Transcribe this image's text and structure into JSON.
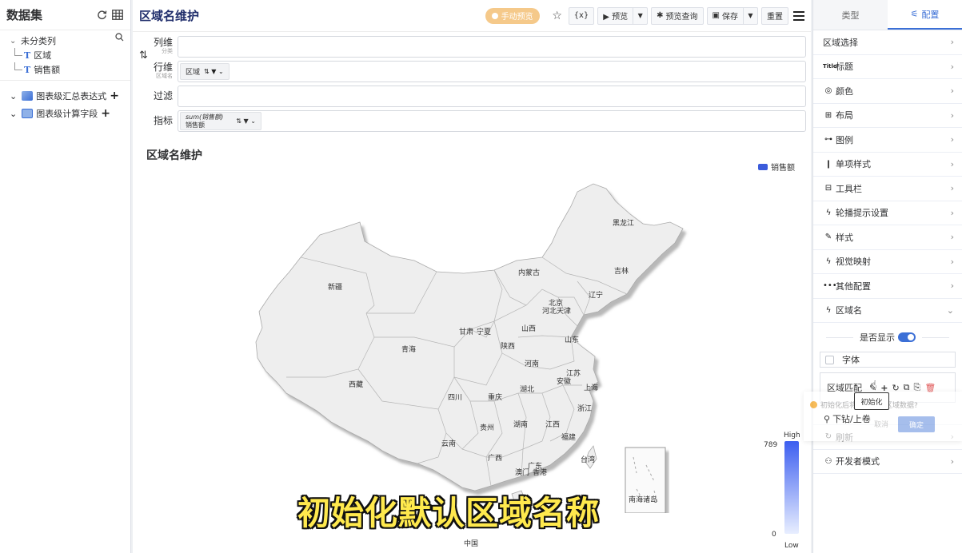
{
  "left_panel": {
    "title": "数据集",
    "tree_root": "未分类列",
    "fields": [
      {
        "icon": "T",
        "label": "区域"
      },
      {
        "icon": "T",
        "label": "销售额"
      }
    ],
    "groups": [
      "图表级汇总表达式",
      "图表级计算字段"
    ]
  },
  "topbar": {
    "title": "区域名维护",
    "manual_preview": "手动预览",
    "var_button": "{x}",
    "preview": "▶ 预览",
    "preview_query": "预览查询",
    "save": "保存",
    "reset": "重置"
  },
  "fields": {
    "column": {
      "label": "列维",
      "sub": "分类"
    },
    "row": {
      "label": "行维",
      "sub": "区域名",
      "chip": "区域"
    },
    "filter": {
      "label": "过滤"
    },
    "metric": {
      "label": "指标",
      "chip_agg": "sum",
      "chip_agg_hint": "(销售额)",
      "chip_name": "销售额"
    }
  },
  "chart_data": {
    "type": "map",
    "title": "区域名维护",
    "legend": [
      "销售额"
    ],
    "series_color": "#3b5bdb",
    "visual_map": {
      "min": 0,
      "max": 789,
      "high_label": "High",
      "low_label": "Low"
    },
    "bottom_label": "中国",
    "regions": [
      "黑龙江",
      "吉林",
      "辽宁",
      "内蒙古",
      "北京",
      "河北",
      "天津",
      "新疆",
      "甘肃",
      "宁夏",
      "山西",
      "山东",
      "青海",
      "陕西",
      "河南",
      "江苏",
      "安徽",
      "上海",
      "西藏",
      "四川",
      "重庆",
      "湖北",
      "浙江",
      "湖南",
      "江西",
      "贵州",
      "福建",
      "云南",
      "广西",
      "广东",
      "台湾",
      "澳门",
      "香港",
      "南海诸岛"
    ]
  },
  "subtitle": "初始化默认区域名称",
  "right_panel": {
    "tabs": [
      "类型",
      "配置"
    ],
    "items_top": [
      {
        "icon": "",
        "label": "区域选择"
      },
      {
        "icon": "Title",
        "label": "标题"
      },
      {
        "icon": "◎",
        "label": "颜色"
      },
      {
        "icon": "⊞",
        "label": "布局"
      },
      {
        "icon": "⊶",
        "label": "图例"
      },
      {
        "icon": "❙",
        "label": "单项样式"
      },
      {
        "icon": "⊟",
        "label": "工具栏"
      },
      {
        "icon": "ϟ",
        "label": "轮播提示设置"
      },
      {
        "icon": "✎",
        "label": "样式"
      },
      {
        "icon": "ϟ",
        "label": "视觉映射"
      },
      {
        "icon": "•••",
        "label": "其他配置"
      },
      {
        "icon": "ϟ",
        "label": "区域名"
      }
    ],
    "region_name": {
      "show_label": "是否显示",
      "font_label": "字体",
      "match_label": "区域匹配",
      "tooltip": "初始化",
      "confirm_msg": "初始化后将覆盖现有区域数据?",
      "cancel": "取消",
      "ok": "确定",
      "drill_label": "下钻/上卷"
    },
    "items_bottom": [
      {
        "icon": "↻",
        "label": "刷新"
      },
      {
        "icon": "⚇",
        "label": "开发者模式"
      }
    ]
  }
}
